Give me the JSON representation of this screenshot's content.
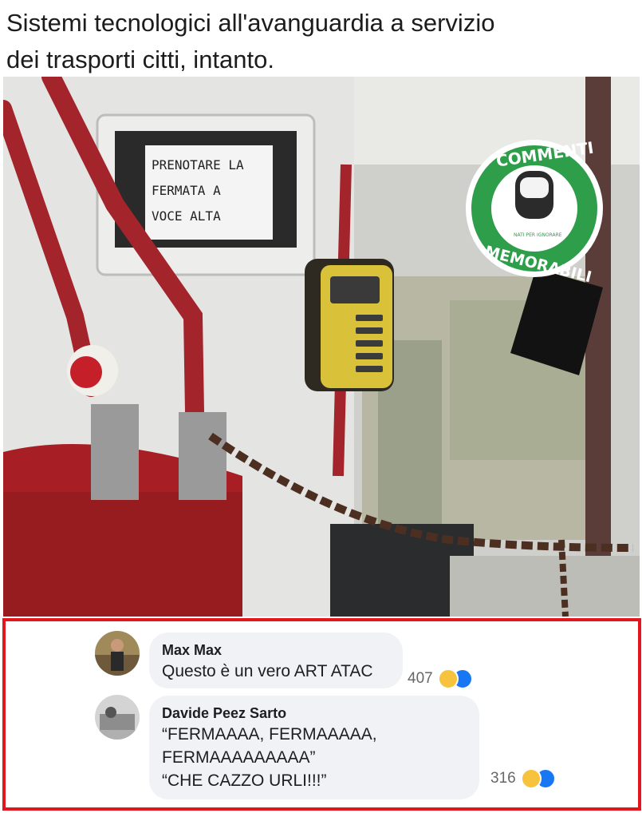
{
  "post": {
    "caption_line1": "Sistemi tecnologici all'avanguardia a servizio",
    "caption_line2": "dei trasporti citti, intanto."
  },
  "photo": {
    "sign_line1": "PRENOTARE LA",
    "sign_line2": "FERMATA A",
    "sign_line3": "VOCE ALTA",
    "badge_top": "COMMENTI",
    "badge_bottom": "MEMORABILI",
    "badge_small": "NATI PER IGNORARE",
    "badge_color": "#2e9e4b"
  },
  "comments": [
    {
      "author": "Max Max",
      "lines": [
        "Questo è un vero ART ATAC"
      ],
      "reaction_count": "407",
      "reactions": [
        "haha-icon",
        "like-icon"
      ]
    },
    {
      "author": "Davide Peez Sarto",
      "lines": [
        "“FERMAAAA, FERMAAAAA,",
        "FERMAAAAAAAAA”",
        "“CHE CAZZO URLI!!!”"
      ],
      "reaction_count": "316",
      "reactions": [
        "haha-icon",
        "like-icon"
      ]
    }
  ],
  "colors": {
    "highlight_border": "#e3161d",
    "bubble": "#f0f2f5",
    "like": "#1877f2",
    "haha": "#f7c23c"
  }
}
